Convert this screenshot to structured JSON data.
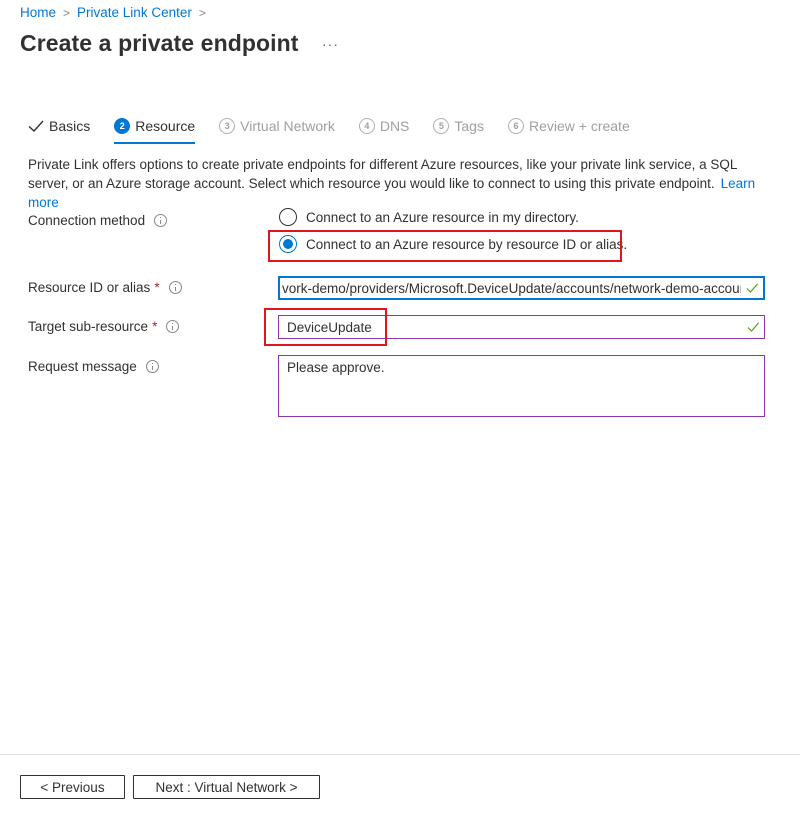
{
  "breadcrumb": {
    "items": [
      "Home",
      "Private Link Center"
    ],
    "separator": ">"
  },
  "header": {
    "title": "Create a private endpoint",
    "more_label": "···"
  },
  "tabs": [
    {
      "number": "",
      "label": "Basics",
      "state": "done"
    },
    {
      "number": "2",
      "label": "Resource",
      "state": "active"
    },
    {
      "number": "3",
      "label": "Virtual Network",
      "state": "disabled"
    },
    {
      "number": "4",
      "label": "DNS",
      "state": "disabled"
    },
    {
      "number": "5",
      "label": "Tags",
      "state": "disabled"
    },
    {
      "number": "6",
      "label": "Review + create",
      "state": "disabled"
    }
  ],
  "description": {
    "text": "Private Link offers options to create private endpoints for different Azure resources, like your private link service, a SQL server, or an Azure storage account. Select which resource you would like to connect to using this private endpoint.",
    "link": "Learn more"
  },
  "form": {
    "connection_method": {
      "label": "Connection method",
      "options": [
        {
          "label": "Connect to an Azure resource in my directory.",
          "checked": false
        },
        {
          "label": "Connect to an Azure resource by resource ID or alias.",
          "checked": true
        }
      ]
    },
    "resource_id": {
      "label": "Resource ID or alias",
      "required": "*",
      "value": "vork-demo/providers/Microsoft.DeviceUpdate/accounts/network-demo-account"
    },
    "target_sub_resource": {
      "label": "Target sub-resource",
      "required": "*",
      "value": "DeviceUpdate"
    },
    "request_message": {
      "label": "Request message",
      "value": "Please approve."
    }
  },
  "footer": {
    "previous_label": "< Previous",
    "next_label": "Next : Virtual Network >"
  },
  "colors": {
    "accent": "#0078d4",
    "highlight": "#e0161f",
    "valid": "#57a300",
    "input_border_purple": "#8a36b0"
  }
}
